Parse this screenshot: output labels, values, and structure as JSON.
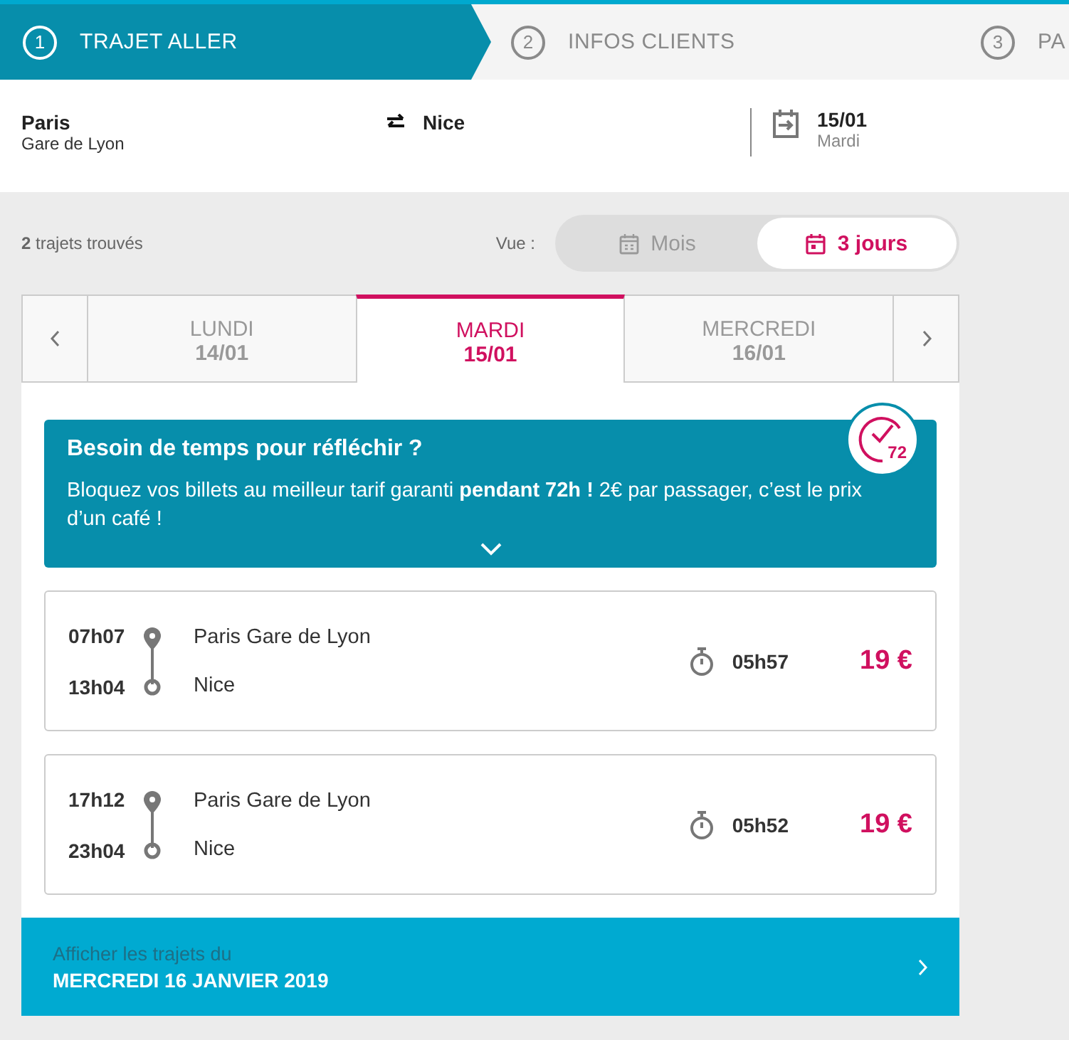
{
  "steps": [
    {
      "number": "1",
      "label": "TRAJET ALLER",
      "selected": true
    },
    {
      "number": "2",
      "label": "INFOS CLIENTS",
      "selected": false
    },
    {
      "number": "3",
      "label": "PA",
      "selected": false
    }
  ],
  "search": {
    "origin": "Paris",
    "origin_detail": "Gare de Lyon",
    "destination": "Nice",
    "date": "15/01",
    "weekday": "Mardi"
  },
  "results_count": "**2** trajets trouvés",
  "view": {
    "label": "Vue :",
    "options": [
      {
        "kind": "month",
        "label": "Mois",
        "selected": false
      },
      {
        "kind": "days",
        "label": "3 jours",
        "selected": true
      }
    ]
  },
  "day_tabs": [
    {
      "day": "LUNDI",
      "date": "14/01",
      "selected": false
    },
    {
      "day": "MARDI",
      "date": "15/01",
      "selected": true
    },
    {
      "day": "MERCREDI",
      "date": "16/01",
      "selected": false
    }
  ],
  "promo": {
    "title": "Besoin de temps pour réfléchir ?",
    "text": "Bloquez vos billets au meilleur tarif garanti **pendant 72h !** 2€ par passager, c’est le prix d’un café !",
    "badge": "72"
  },
  "trips": [
    {
      "departure_time": "07h07",
      "arrival_time": "13h04",
      "origin": "Paris Gare de Lyon",
      "destination": "Nice",
      "duration": "05h57",
      "price": "19 €"
    },
    {
      "departure_time": "17h12",
      "arrival_time": "23h04",
      "origin": "Paris Gare de Lyon",
      "destination": "Nice",
      "duration": "05h52",
      "price": "19 €"
    }
  ],
  "next_day": {
    "label": "Afficher les trajets du",
    "date": "MERCREDI 16 JANVIER 2019"
  }
}
